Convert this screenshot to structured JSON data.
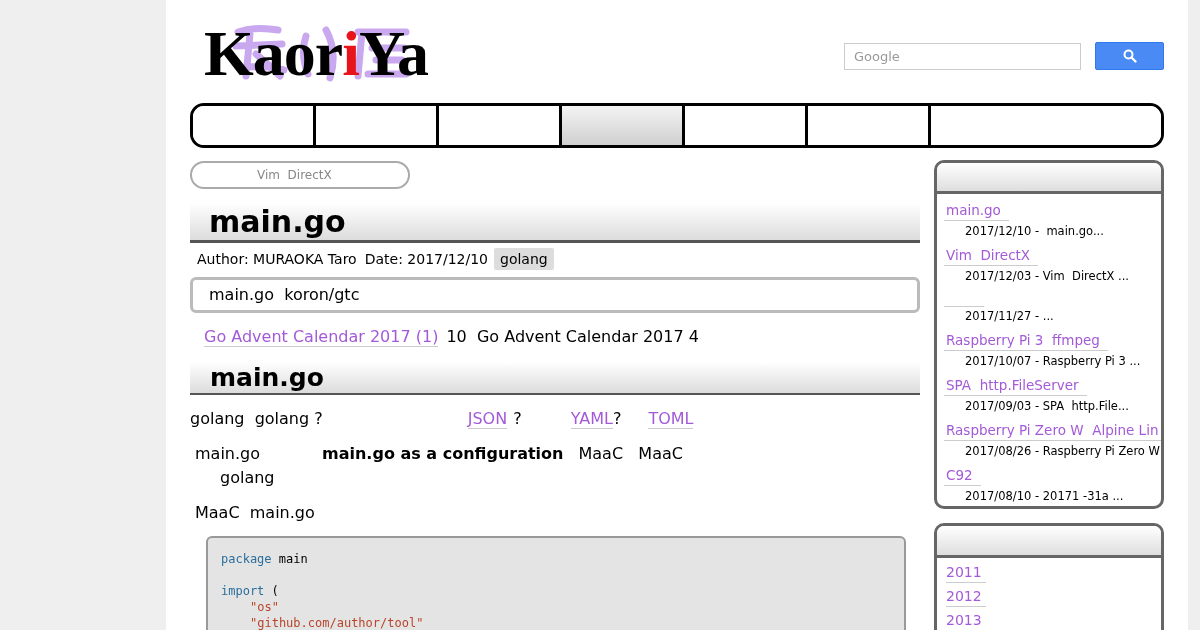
{
  "logo": {
    "parts": [
      {
        "text": "Kaor",
        "accent": false
      },
      {
        "text": "i",
        "accent": true
      },
      {
        "text": "Ya",
        "accent": false
      }
    ]
  },
  "search": {
    "placeholder": "Google"
  },
  "nav": {
    "tabs": [
      {
        "selected": false
      },
      {
        "selected": false
      },
      {
        "selected": false
      },
      {
        "selected": true
      },
      {
        "selected": false
      },
      {
        "selected": false
      },
      {
        "selected": false
      }
    ]
  },
  "breadcrumb": "Vim  DirectX",
  "article": {
    "title": "main.go",
    "author": "Author: MURAOKA Taro",
    "date": "Date: 2017/12/10",
    "tag": "golang",
    "summary": "main.go  koron/gtc",
    "intro": [
      {
        "kind": "link",
        "text": "Go Advent Calendar 2017 (1)"
      },
      {
        "kind": "text",
        "text": "10  Go Advent Calendar 2017 4"
      }
    ],
    "section_title": "main.go",
    "paragraphs": [
      {
        "lines": [
          [
            {
              "kind": "text",
              "text": "golang  golang ?"
            },
            {
              "kind": "link",
              "text": "JSON"
            },
            {
              "kind": "text",
              "text": "?"
            },
            {
              "kind": "link",
              "text": "YAML"
            },
            {
              "kind": "text",
              "text": "?"
            },
            {
              "kind": "link",
              "text": "TOML"
            }
          ]
        ]
      },
      {
        "lines": [
          [
            {
              "kind": "text",
              "text": "main.go"
            },
            {
              "kind": "bold",
              "text": "main.go as a configuration"
            },
            {
              "kind": "text",
              "text": "MaaC   MaaC"
            }
          ],
          [
            {
              "kind": "text",
              "text": "golang"
            }
          ]
        ]
      },
      {
        "lines": [
          [
            {
              "kind": "text",
              "text": "MaaC  main.go"
            }
          ]
        ]
      }
    ],
    "code": [
      {
        "tokens": [
          {
            "kind": "keyword",
            "text": "package"
          },
          {
            "kind": "plain",
            "text": " main"
          }
        ]
      },
      {
        "blank_before": true,
        "tokens": [
          {
            "kind": "keyword",
            "text": "import"
          },
          {
            "kind": "plain",
            "text": " ("
          }
        ]
      },
      {
        "indent": true,
        "tokens": [
          {
            "kind": "string",
            "text": "\"os\""
          }
        ]
      },
      {
        "indent": true,
        "tokens": [
          {
            "kind": "string",
            "text": "\"github.com/author/tool\""
          }
        ]
      }
    ]
  },
  "sidebar": {
    "recent": [
      {
        "title": "main.go",
        "excerpt": "2017/12/10 -  main.go..."
      },
      {
        "title": "Vim  DirectX",
        "excerpt": "2017/12/03 - Vim  DirectX ..."
      },
      {
        "excerpt": "2017/11/27 - ..."
      },
      {
        "title": "Raspberry Pi 3  ffmpeg",
        "excerpt": "2017/10/07 - Raspberry Pi 3 ..."
      },
      {
        "title": "SPA  http.FileServer",
        "excerpt": "2017/09/03 - SPA  http.File..."
      },
      {
        "title": "Raspberry Pi Zero W  Alpine Lin",
        "excerpt": "2017/08/26 - Raspberry Pi Zero W"
      },
      {
        "title": "C92",
        "excerpt": "2017/08/10 - 20171 -31a ..."
      }
    ],
    "archive": [
      "2011",
      "2012",
      "2013"
    ]
  }
}
